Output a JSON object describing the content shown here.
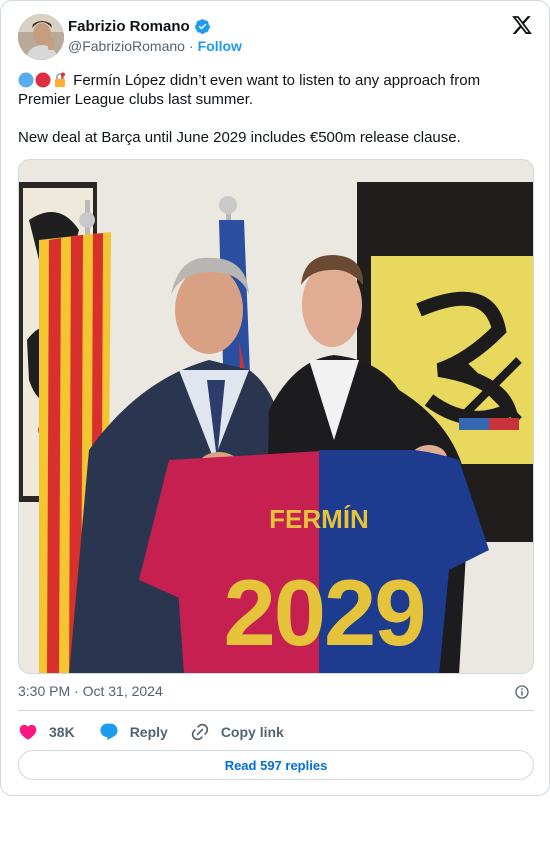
{
  "author": {
    "name": "Fabrizio Romano",
    "handle": "@FabrizioRomano",
    "separator": "·",
    "follow_label": "Follow"
  },
  "tweet": {
    "emojis": [
      "blue-circle",
      "red-circle",
      "lock-with-key"
    ],
    "line1": "Fermín López didn’t even want to listen to any approach from Premier League clubs last summer.",
    "line2": "New deal at Barça until June 2029 includes €500m release clause."
  },
  "photo": {
    "shirt_name": "FERMÍN",
    "shirt_number": "2029"
  },
  "meta": {
    "timestamp": "3:30 PM · Oct 31, 2024"
  },
  "actions": {
    "like_count": "38K",
    "reply_label": "Reply",
    "copy_label": "Copy link"
  },
  "read_replies_label": "Read 597 replies",
  "colors": {
    "accent_blue": "#1d9bf0",
    "link_blue": "#006fd6",
    "like_pink": "#f91880",
    "text_secondary": "#536471",
    "border": "#cfd9de"
  }
}
